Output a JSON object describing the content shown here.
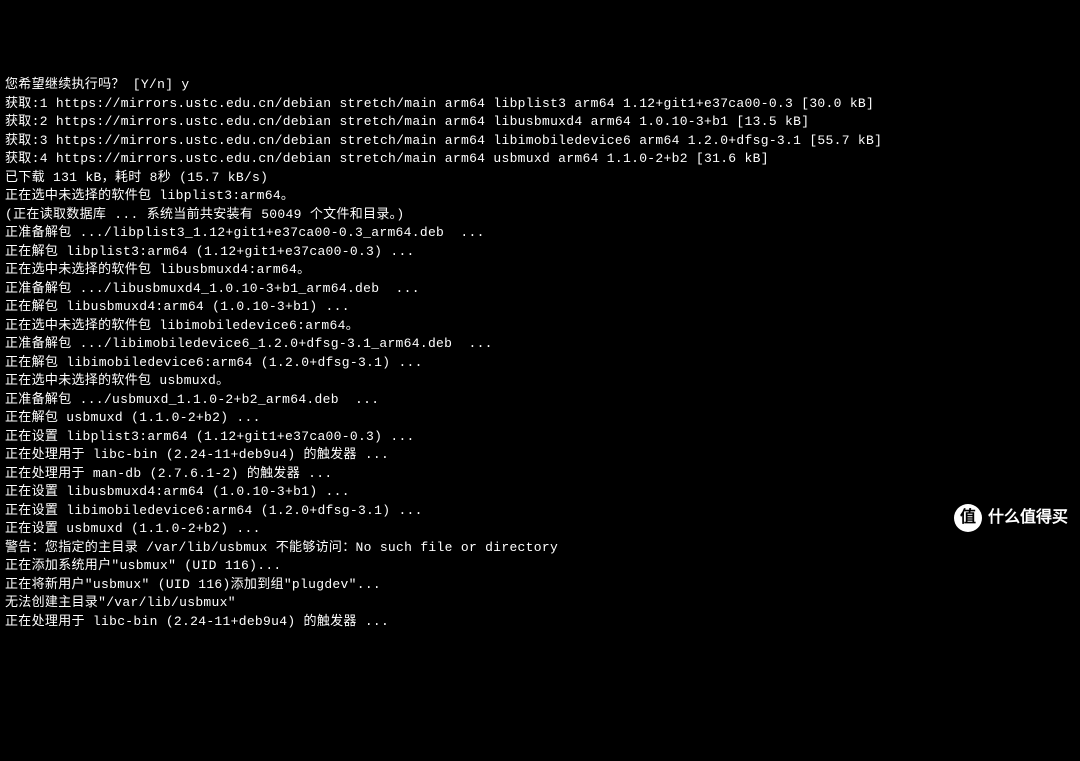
{
  "terminal": {
    "lines": [
      "您希望继续执行吗？ [Y/n] y",
      "获取:1 https://mirrors.ustc.edu.cn/debian stretch/main arm64 libplist3 arm64 1.12+git1+e37ca00-0.3 [30.0 kB]",
      "获取:2 https://mirrors.ustc.edu.cn/debian stretch/main arm64 libusbmuxd4 arm64 1.0.10-3+b1 [13.5 kB]",
      "获取:3 https://mirrors.ustc.edu.cn/debian stretch/main arm64 libimobiledevice6 arm64 1.2.0+dfsg-3.1 [55.7 kB]",
      "获取:4 https://mirrors.ustc.edu.cn/debian stretch/main arm64 usbmuxd arm64 1.1.0-2+b2 [31.6 kB]",
      "已下载 131 kB，耗时 8秒 (15.7 kB/s)",
      "正在选中未选择的软件包 libplist3:arm64。",
      "(正在读取数据库 ... 系统当前共安装有 50049 个文件和目录。)",
      "正准备解包 .../libplist3_1.12+git1+e37ca00-0.3_arm64.deb  ...",
      "正在解包 libplist3:arm64 (1.12+git1+e37ca00-0.3) ...",
      "正在选中未选择的软件包 libusbmuxd4:arm64。",
      "正准备解包 .../libusbmuxd4_1.0.10-3+b1_arm64.deb  ...",
      "正在解包 libusbmuxd4:arm64 (1.0.10-3+b1) ...",
      "正在选中未选择的软件包 libimobiledevice6:arm64。",
      "正准备解包 .../libimobiledevice6_1.2.0+dfsg-3.1_arm64.deb  ...",
      "正在解包 libimobiledevice6:arm64 (1.2.0+dfsg-3.1) ...",
      "正在选中未选择的软件包 usbmuxd。",
      "正准备解包 .../usbmuxd_1.1.0-2+b2_arm64.deb  ...",
      "正在解包 usbmuxd (1.1.0-2+b2) ...",
      "正在设置 libplist3:arm64 (1.12+git1+e37ca00-0.3) ...",
      "正在处理用于 libc-bin (2.24-11+deb9u4) 的触发器 ...",
      "正在处理用于 man-db (2.7.6.1-2) 的触发器 ...",
      "正在设置 libusbmuxd4:arm64 (1.0.10-3+b1) ...",
      "正在设置 libimobiledevice6:arm64 (1.2.0+dfsg-3.1) ...",
      "正在设置 usbmuxd (1.1.0-2+b2) ...",
      "警告：您指定的主目录 /var/lib/usbmux 不能够访问：No such file or directory",
      "正在添加系统用户\"usbmux\" (UID 116)...",
      "正在将新用户\"usbmux\" (UID 116)添加到组\"plugdev\"...",
      "无法创建主目录\"/var/lib/usbmux\"",
      "正在处理用于 libc-bin (2.24-11+deb9u4) 的触发器 ..."
    ]
  },
  "watermark": {
    "icon": "值",
    "text": "什么值得买"
  }
}
